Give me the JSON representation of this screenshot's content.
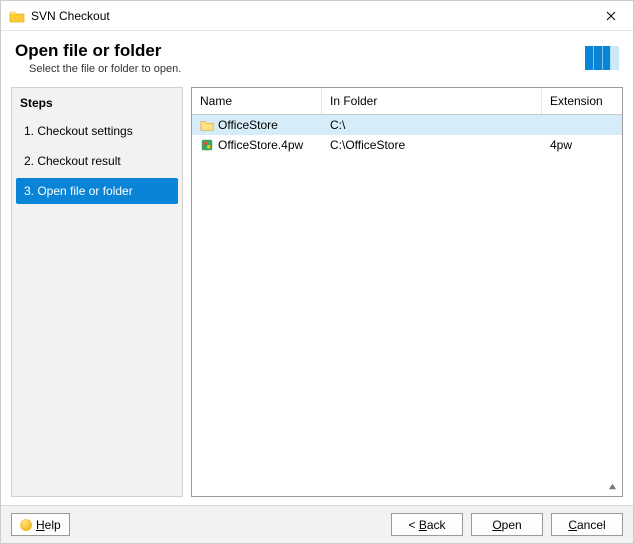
{
  "window": {
    "title": "SVN Checkout"
  },
  "header": {
    "title": "Open file or folder",
    "subtitle": "Select the file or folder to open."
  },
  "sidebar": {
    "title": "Steps",
    "steps": [
      {
        "label": "1. Checkout settings"
      },
      {
        "label": "2. Checkout result"
      },
      {
        "label": "3. Open file or folder"
      }
    ],
    "active_index": 2
  },
  "table": {
    "columns": {
      "name": "Name",
      "folder": "In Folder",
      "ext": "Extension"
    },
    "rows": [
      {
        "icon": "folder",
        "name": "OfficeStore",
        "folder": "C:\\",
        "ext": "",
        "selected": true
      },
      {
        "icon": "file",
        "name": "OfficeStore.4pw",
        "folder": "C:\\OfficeStore",
        "ext": "4pw",
        "selected": false
      }
    ]
  },
  "footer": {
    "help": "Help",
    "back": "< Back",
    "open": "Open",
    "cancel": "Cancel"
  }
}
